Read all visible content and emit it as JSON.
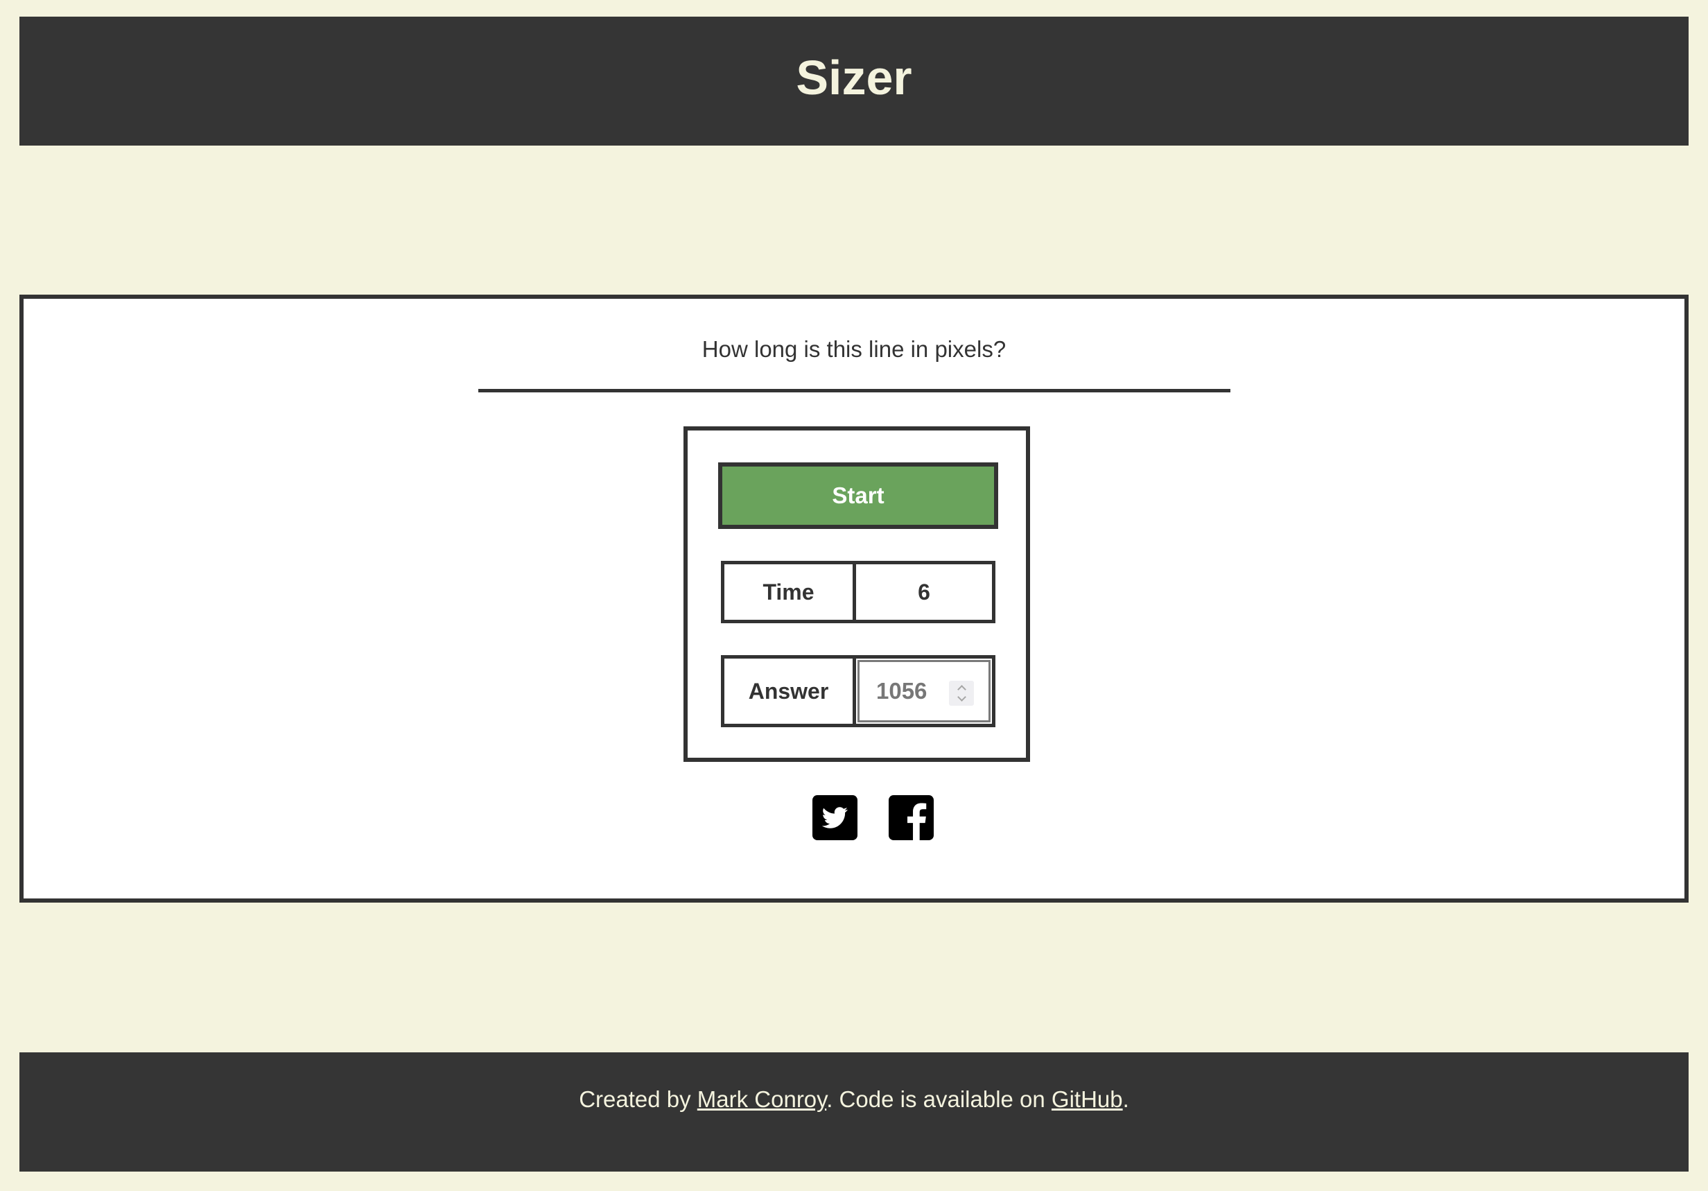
{
  "header": {
    "title": "Sizer"
  },
  "game": {
    "question": "How long is this line in pixels?",
    "start_label": "Start",
    "time_label": "Time",
    "time_value": "6",
    "answer_label": "Answer",
    "answer_placeholder": "1056"
  },
  "share": {
    "icons": [
      "twitter-icon",
      "facebook-icon"
    ]
  },
  "footer": {
    "prefix": "Created by ",
    "author_link": "Mark Conroy",
    "middle": ". Code is available on ",
    "repo_link": "GitHub",
    "suffix": "."
  },
  "colors": {
    "background": "#f4f3de",
    "dark": "#353535",
    "border": "#333333",
    "start_button": "#6aa35c",
    "panel": "#ffffff"
  }
}
